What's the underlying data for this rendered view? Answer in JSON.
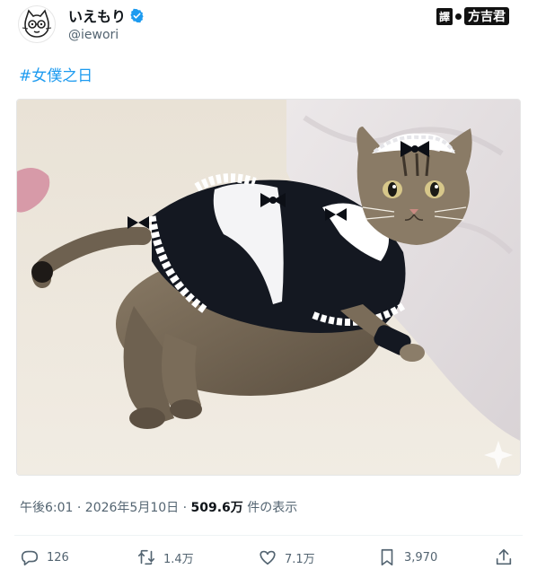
{
  "post": {
    "display_name": "いえもり",
    "handle": "@iewori",
    "text": "#女僕之日",
    "timestamp": "午後6:01 · 2026年5月10日 · ",
    "views": "509.6万",
    "views_suffix": " 件の表示"
  },
  "watermark": {
    "prefix": "譯",
    "text": "方吉君"
  },
  "actions": {
    "reply": {
      "icon": "reply-icon",
      "count": "126"
    },
    "repost": {
      "icon": "repost-icon",
      "count": "1.4万"
    },
    "like": {
      "icon": "heart-icon",
      "count": "7.1万"
    },
    "bookmark": {
      "icon": "bookmark-icon",
      "count": "3,970"
    },
    "share": {
      "icon": "share-icon"
    }
  },
  "colors": {
    "accent": "#1d9bf0",
    "muted_text": "#536471",
    "primary_text": "#0f1419"
  }
}
